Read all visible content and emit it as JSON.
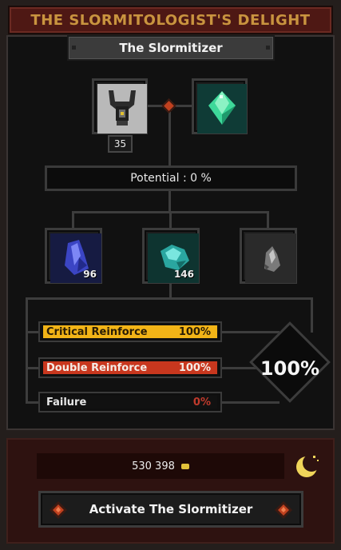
{
  "header": {
    "title": "THE SLORMITOLOGIST'S DELIGHT"
  },
  "panel": {
    "subtitle": "The Slormitizer"
  },
  "item_slot": {
    "icon": "amulet-icon",
    "level": "35"
  },
  "gem_slot": {
    "icon": "green-crystal-icon"
  },
  "potential": {
    "text": "Potential : 0 %"
  },
  "materials": [
    {
      "icon": "blue-shard-icon",
      "count": "96"
    },
    {
      "icon": "teal-shard-icon",
      "count": "146"
    },
    {
      "icon": "grey-shard-icon",
      "count": ""
    }
  ],
  "results": [
    {
      "label": "Critical Reinforce",
      "value": "100%",
      "color": "#f2b417"
    },
    {
      "label": "Double Reinforce",
      "value": "100%",
      "color": "#c8371e"
    },
    {
      "label": "Failure",
      "value": "0%",
      "color": "#111111"
    }
  ],
  "success_chance": "100%",
  "gold": {
    "amount": "530 398",
    "icon": "gold-coin-icon"
  },
  "moon_icon": "crescent-moon-icon",
  "activate_button": {
    "label": "Activate The Slormitizer"
  },
  "colors": {
    "title_text": "#c9943f",
    "title_bg": "#4e1814",
    "accent_red": "#c0411f"
  }
}
